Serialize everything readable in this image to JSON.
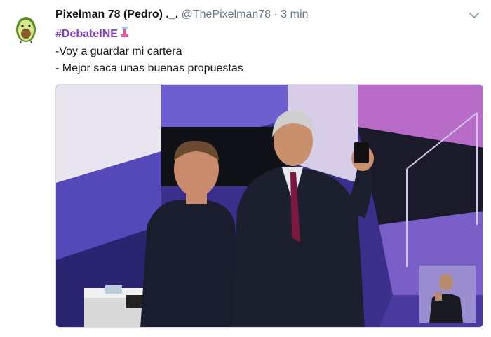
{
  "tweet": {
    "display_name": "Pixelman 78 (Pedro) ._.",
    "handle": "@ThePixelman78",
    "separator": "·",
    "timestamp": "3 min",
    "hashtag": "#DebateINE",
    "lines": [
      "-Voy a guardar mi cartera",
      "- Mejor saca unas buenas propuestas"
    ],
    "avatar_icon": "avocado-icon",
    "hashtag_emoji_icon": "podium-emoji-icon",
    "menu_icon": "chevron-down-icon"
  },
  "colors": {
    "text": "#14171a",
    "secondary": "#657786",
    "hashtag": "#7b3fbf",
    "stage_purple": "#5a3fb0",
    "stage_navy": "#1e1a5a"
  }
}
